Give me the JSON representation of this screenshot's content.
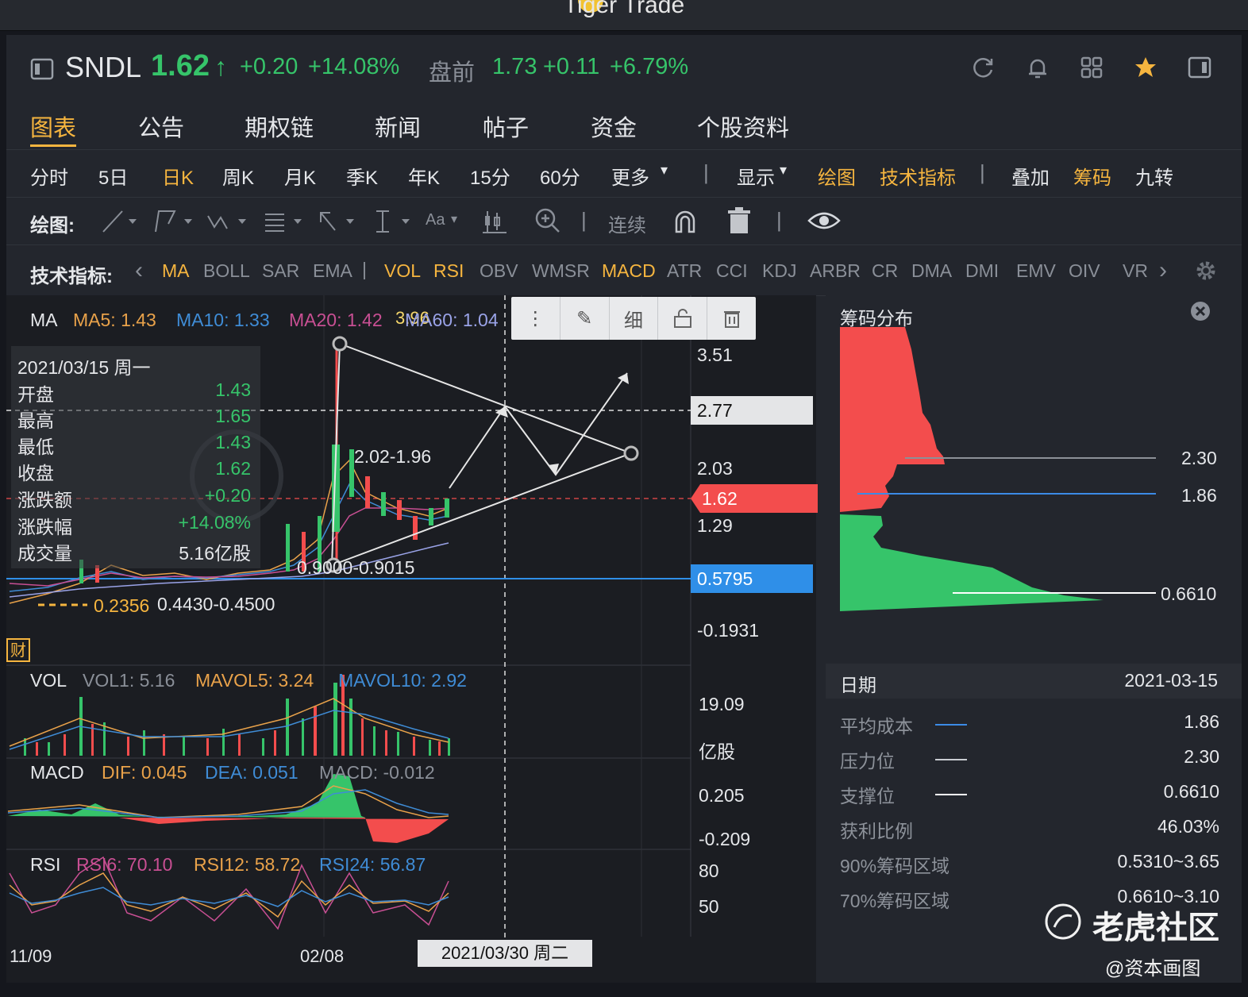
{
  "window": {
    "title": "Tiger Trade"
  },
  "quote": {
    "symbol": "SNDL",
    "price": "1.62",
    "arrow": "↑",
    "change": "+0.20",
    "change_pct": "+14.08%",
    "premarket_label": "盘前",
    "pre_price": "1.73",
    "pre_change": "+0.11",
    "pre_change_pct": "+6.79%"
  },
  "tabs": [
    "图表",
    "公告",
    "期权链",
    "新闻",
    "帖子",
    "资金",
    "个股资料"
  ],
  "periods": [
    "分时",
    "5日",
    "日K",
    "周K",
    "月K",
    "季K",
    "年K",
    "15分",
    "60分",
    "更多"
  ],
  "period_right": {
    "display": "显示",
    "draw": "绘图",
    "indicators": "技术指标",
    "overlay": "叠加",
    "chips": "筹码",
    "nine": "九转"
  },
  "draw_tools": {
    "label": "绘图:",
    "continuous": "连续",
    "text_tool": "Aa"
  },
  "indicator_bar": {
    "label": "技术指标:",
    "items": [
      {
        "name": "MA",
        "active": true
      },
      {
        "name": "BOLL",
        "active": false
      },
      {
        "name": "SAR",
        "active": false
      },
      {
        "name": "EMA",
        "active": false
      },
      {
        "name": "|",
        "active": false
      },
      {
        "name": "VOL",
        "active": true
      },
      {
        "name": "RSI",
        "active": true
      },
      {
        "name": "OBV",
        "active": false
      },
      {
        "name": "WMSR",
        "active": false
      },
      {
        "name": "MACD",
        "active": true
      },
      {
        "name": "ATR",
        "active": false
      },
      {
        "name": "CCI",
        "active": false
      },
      {
        "name": "KDJ",
        "active": false
      },
      {
        "name": "ARBR",
        "active": false
      },
      {
        "name": "CR",
        "active": false
      },
      {
        "name": "DMA",
        "active": false
      },
      {
        "name": "DMI",
        "active": false
      },
      {
        "name": "EMV",
        "active": false
      },
      {
        "name": "OIV",
        "active": false
      },
      {
        "name": "VR",
        "active": false
      }
    ]
  },
  "ma_legend": {
    "label": "MA",
    "ma5": "MA5: 1.43",
    "ma10": "MA10: 1.33",
    "ma20": "MA20: 1.42",
    "ma60": "MA60: 1.04",
    "overlap": "3.96"
  },
  "float_toolbar": {
    "detail": "细"
  },
  "info": {
    "date": "2021/03/15 周一",
    "rows": [
      {
        "k": "开盘",
        "v": "1.43"
      },
      {
        "k": "最高",
        "v": "1.65"
      },
      {
        "k": "最低",
        "v": "1.43"
      },
      {
        "k": "收盘",
        "v": "1.62"
      },
      {
        "k": "涨跌额",
        "v": "+0.20"
      },
      {
        "k": "涨跌幅",
        "v": "+14.08%"
      },
      {
        "k": "成交量",
        "v": "5.16亿股"
      }
    ]
  },
  "annotations": {
    "a1": "2.02-1.96",
    "a2": "0.9000-0.9015",
    "a3": "0.4430-0.4500",
    "a4": "0.2356"
  },
  "price_axis": {
    "p1": "3.51",
    "cross": "2.77",
    "p2": "2.03",
    "last": "1.62",
    "p3": "1.29",
    "blue": "0.5795",
    "p4": "-0.1931"
  },
  "fin_badge": "财",
  "vol_legend": {
    "label": "VOL",
    "v1": "VOL1: 5.16",
    "v2": "MAVOL5: 3.24",
    "v3": "MAVOL10: 2.92",
    "axis_top": "19.09",
    "unit": "亿股"
  },
  "macd_legend": {
    "label": "MACD",
    "dif": "DIF: 0.045",
    "dea": "DEA: 0.051",
    "macd": "MACD: -0.012",
    "axis_top": "0.205",
    "axis_bottom": "-0.209"
  },
  "rsi_legend": {
    "label": "RSI",
    "r6": "RSI6: 70.10",
    "r12": "RSI12: 58.72",
    "r24": "RSI24: 56.87",
    "a80": "80",
    "a50": "50"
  },
  "time_axis": {
    "t1": "11/09",
    "t2": "02/08",
    "cursor": "2021/03/30 周二"
  },
  "chips": {
    "title": "筹码分布",
    "levels": {
      "high": "2.30",
      "avg": "1.86",
      "low": "0.6610"
    },
    "date_label": "日期",
    "date_value": "2021-03-15",
    "rows": [
      {
        "k": "平均成本",
        "v": "1.86",
        "line": "#3c8be6"
      },
      {
        "k": "压力位",
        "v": "2.30",
        "line": "#c9ccd1"
      },
      {
        "k": "支撑位",
        "v": "0.6610",
        "line": "#ffffff"
      },
      {
        "k": "获利比例",
        "v": "46.03%"
      },
      {
        "k": "90%筹码区域",
        "v": "0.5310~3.65"
      },
      {
        "k": "70%筹码区域",
        "v": "0.6610~3.10"
      }
    ]
  },
  "watermark": {
    "brand": "老虎社区",
    "author": "@资本画图"
  },
  "colors": {
    "up": "#36c46a",
    "down": "#f34d4d",
    "accent": "#f6b53f",
    "blue": "#2f8fe8"
  }
}
